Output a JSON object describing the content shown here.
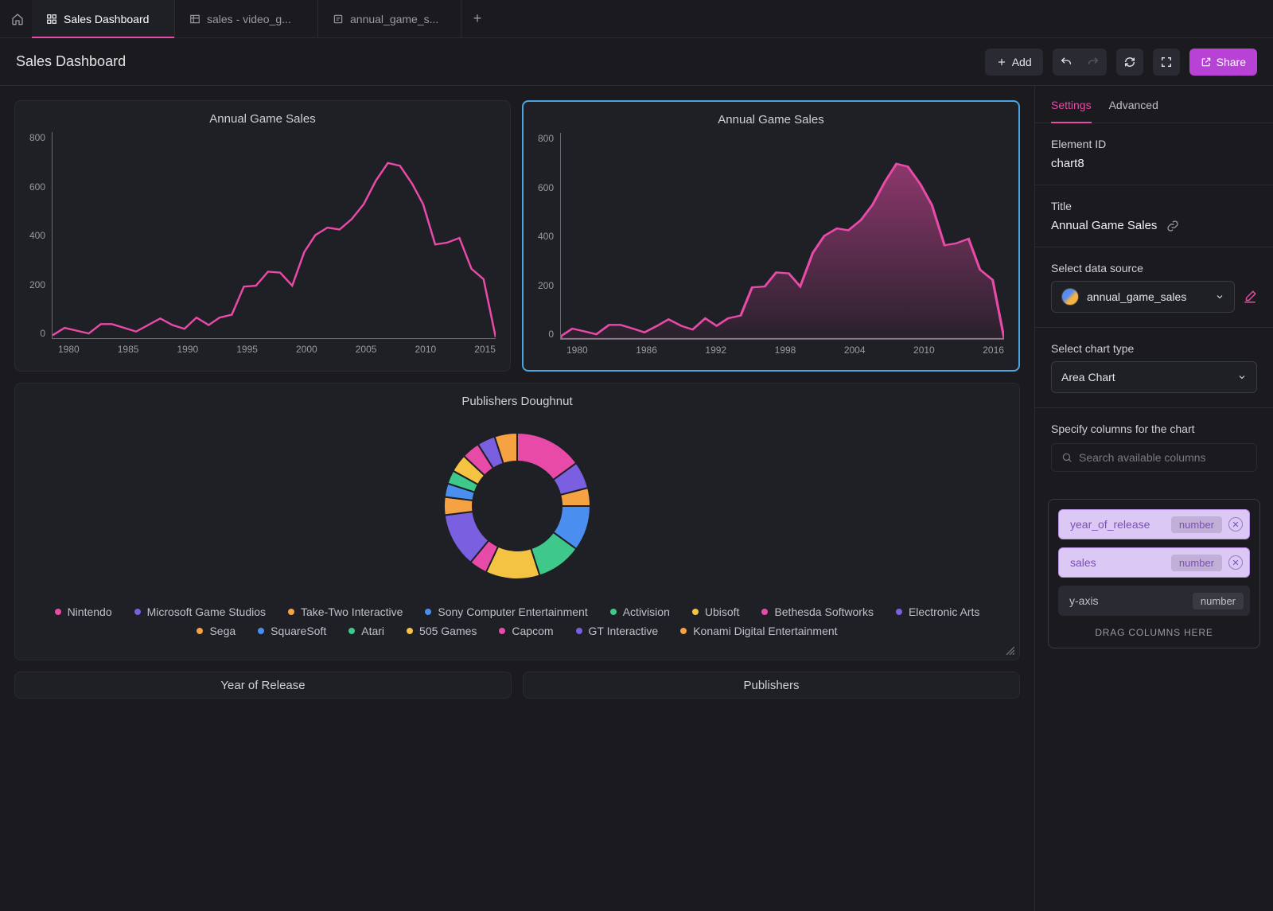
{
  "tabs": [
    {
      "label": "Sales Dashboard",
      "active": true,
      "icon": "dashboard"
    },
    {
      "label": "sales - video_g...",
      "active": false,
      "icon": "table"
    },
    {
      "label": "annual_game_s...",
      "active": false,
      "icon": "query"
    }
  ],
  "header": {
    "title": "Sales Dashboard",
    "add_label": "Add",
    "share_label": "Share"
  },
  "charts": {
    "line": {
      "title": "Annual Game Sales",
      "y_ticks": [
        "800",
        "600",
        "400",
        "200",
        "0"
      ],
      "x_ticks": [
        "1980",
        "1985",
        "1990",
        "1995",
        "2000",
        "2005",
        "2010",
        "2015"
      ]
    },
    "area": {
      "title": "Annual Game Sales",
      "y_ticks": [
        "800",
        "600",
        "400",
        "200",
        "0"
      ],
      "x_ticks": [
        "1980",
        "1986",
        "1992",
        "1998",
        "2004",
        "2010",
        "2016"
      ]
    },
    "donut": {
      "title": "Publishers Doughnut",
      "legend": [
        {
          "label": "Nintendo",
          "color": "#e84ba7"
        },
        {
          "label": "Microsoft Game Studios",
          "color": "#7a5fe0"
        },
        {
          "label": "Take-Two Interactive",
          "color": "#f5a342"
        },
        {
          "label": "Sony Computer Entertainment",
          "color": "#4a8ef0"
        },
        {
          "label": "Activision",
          "color": "#3ec98a"
        },
        {
          "label": "Ubisoft",
          "color": "#f5c342"
        },
        {
          "label": "Bethesda Softworks",
          "color": "#e84ba7"
        },
        {
          "label": "Electronic Arts",
          "color": "#7a5fe0"
        },
        {
          "label": "Sega",
          "color": "#f5a342"
        },
        {
          "label": "SquareSoft",
          "color": "#4a8ef0"
        },
        {
          "label": "Atari",
          "color": "#3ec98a"
        },
        {
          "label": "505 Games",
          "color": "#f5c342"
        },
        {
          "label": "Capcom",
          "color": "#e84ba7"
        },
        {
          "label": "GT Interactive",
          "color": "#7a5fe0"
        },
        {
          "label": "Konami Digital Entertainment",
          "color": "#f5a342"
        }
      ]
    },
    "stub1": {
      "title": "Year of Release"
    },
    "stub2": {
      "title": "Publishers"
    }
  },
  "inspector": {
    "tab_settings": "Settings",
    "tab_advanced": "Advanced",
    "element_id_label": "Element ID",
    "element_id": "chart8",
    "title_label": "Title",
    "title_value": "Annual Game Sales",
    "data_source_label": "Select data source",
    "data_source": "annual_game_sales",
    "chart_type_label": "Select chart type",
    "chart_type": "Area Chart",
    "columns_label": "Specify columns for the chart",
    "search_placeholder": "Search available columns",
    "col1_name": "year_of_release",
    "col1_type": "number",
    "col2_name": "sales",
    "col2_type": "number",
    "col3_name": "y-axis",
    "col3_type": "number",
    "drag_hint": "DRAG COLUMNS HERE"
  },
  "chart_data": [
    {
      "type": "line",
      "title": "Annual Game Sales",
      "xlabel": "",
      "ylabel": "",
      "ylim": [
        0,
        800
      ],
      "x": [
        1980,
        1981,
        1982,
        1983,
        1984,
        1985,
        1986,
        1987,
        1988,
        1989,
        1990,
        1991,
        1992,
        1993,
        1994,
        1995,
        1996,
        1997,
        1998,
        1999,
        2000,
        2001,
        2002,
        2003,
        2004,
        2005,
        2006,
        2007,
        2008,
        2009,
        2010,
        2011,
        2012,
        2013,
        2014,
        2015,
        2016,
        2017
      ],
      "values": [
        12,
        40,
        30,
        20,
        55,
        55,
        40,
        25,
        50,
        75,
        50,
        35,
        80,
        50,
        80,
        90,
        200,
        205,
        260,
        255,
        205,
        335,
        400,
        430,
        420,
        460,
        520,
        610,
        680,
        670,
        600,
        520,
        365,
        370,
        390,
        270,
        230,
        5
      ]
    },
    {
      "type": "area",
      "title": "Annual Game Sales",
      "xlabel": "",
      "ylabel": "",
      "ylim": [
        0,
        800
      ],
      "x": [
        1980,
        1981,
        1982,
        1983,
        1984,
        1985,
        1986,
        1987,
        1988,
        1989,
        1990,
        1991,
        1992,
        1993,
        1994,
        1995,
        1996,
        1997,
        1998,
        1999,
        2000,
        2001,
        2002,
        2003,
        2004,
        2005,
        2006,
        2007,
        2008,
        2009,
        2010,
        2011,
        2012,
        2013,
        2014,
        2015,
        2016,
        2017
      ],
      "values": [
        12,
        40,
        30,
        20,
        55,
        55,
        40,
        25,
        50,
        75,
        50,
        35,
        80,
        50,
        80,
        90,
        200,
        205,
        260,
        255,
        205,
        335,
        400,
        430,
        420,
        460,
        520,
        610,
        680,
        670,
        600,
        520,
        365,
        370,
        390,
        270,
        230,
        5
      ]
    },
    {
      "type": "pie",
      "title": "Publishers Doughnut",
      "categories": [
        "Nintendo",
        "Microsoft Game Studios",
        "Take-Two Interactive",
        "Sony Computer Entertainment",
        "Activision",
        "Ubisoft",
        "Bethesda Softworks",
        "Electronic Arts",
        "Sega",
        "SquareSoft",
        "Atari",
        "505 Games",
        "Capcom",
        "GT Interactive",
        "Konami Digital Entertainment"
      ],
      "values": [
        15,
        6,
        4,
        10,
        10,
        12,
        4,
        12,
        4,
        3,
        3,
        4,
        4,
        4,
        5
      ]
    }
  ]
}
